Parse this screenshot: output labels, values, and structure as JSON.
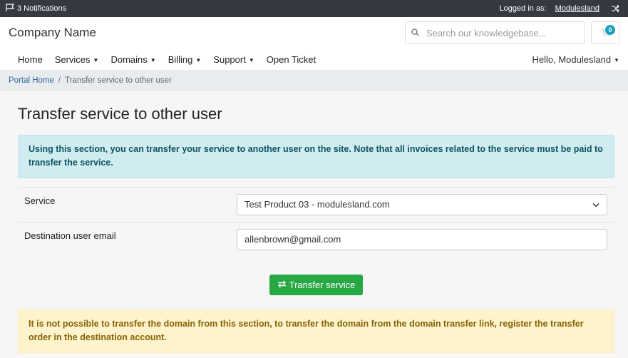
{
  "topbar": {
    "notifications": "3 Notifications",
    "logged_in_label": "Logged in as:",
    "user": "Modulesland"
  },
  "header": {
    "brand": "Company Name",
    "search_placeholder": "Search our knowledgebase...",
    "cart_count": "0"
  },
  "nav": {
    "items": [
      {
        "label": "Home",
        "dropdown": false
      },
      {
        "label": "Services",
        "dropdown": true
      },
      {
        "label": "Domains",
        "dropdown": true
      },
      {
        "label": "Billing",
        "dropdown": true
      },
      {
        "label": "Support",
        "dropdown": true
      },
      {
        "label": "Open Ticket",
        "dropdown": false
      }
    ],
    "greeting": "Hello, Modulesland"
  },
  "breadcrumb": {
    "home": "Portal Home",
    "separator": "/",
    "current": "Transfer service to other user"
  },
  "page": {
    "title": "Transfer service to other user",
    "info_text": "Using this section, you can transfer your service to another user on the site. Note that all invoices related to the service must be paid to transfer the service.",
    "service_label": "Service",
    "service_value": "Test Product 03 - modulesland.com",
    "email_label": "Destination user email",
    "email_value": "allenbrown@gmail.com",
    "button_label": "Transfer service",
    "warning_text": "It is not possible to transfer the domain from this section, to transfer the domain from the domain transfer link, register the transfer order in the destination account."
  },
  "colors": {
    "topbar": "#343a40",
    "accent_info": "#17a2b8",
    "button_green": "#28a745"
  }
}
